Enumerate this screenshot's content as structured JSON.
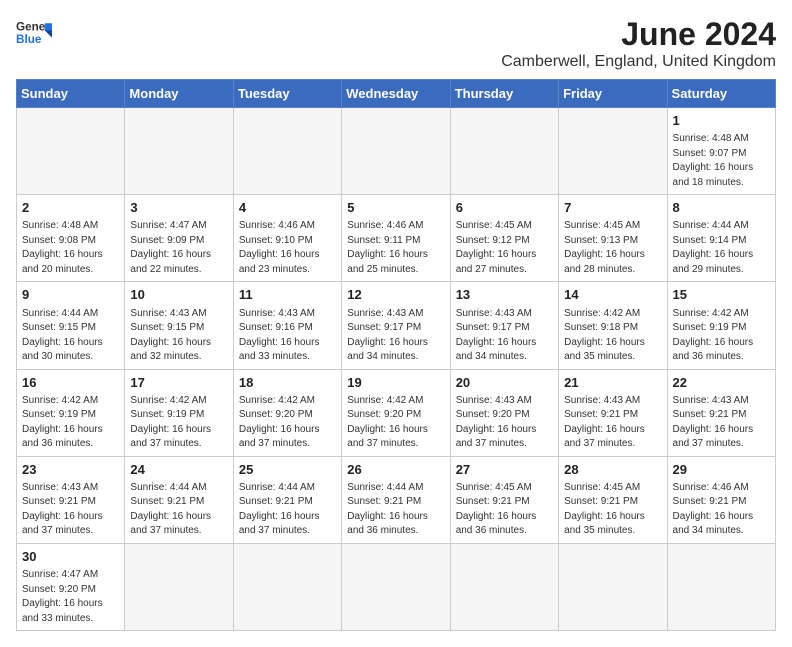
{
  "header": {
    "logo_text_general": "General",
    "logo_text_blue": "Blue",
    "month_title": "June 2024",
    "subtitle": "Camberwell, England, United Kingdom"
  },
  "weekdays": [
    "Sunday",
    "Monday",
    "Tuesday",
    "Wednesday",
    "Thursday",
    "Friday",
    "Saturday"
  ],
  "weeks": [
    [
      {
        "day": "",
        "info": ""
      },
      {
        "day": "",
        "info": ""
      },
      {
        "day": "",
        "info": ""
      },
      {
        "day": "",
        "info": ""
      },
      {
        "day": "",
        "info": ""
      },
      {
        "day": "",
        "info": ""
      },
      {
        "day": "1",
        "info": "Sunrise: 4:48 AM\nSunset: 9:07 PM\nDaylight: 16 hours\nand 18 minutes."
      }
    ],
    [
      {
        "day": "2",
        "info": "Sunrise: 4:48 AM\nSunset: 9:08 PM\nDaylight: 16 hours\nand 20 minutes."
      },
      {
        "day": "3",
        "info": "Sunrise: 4:47 AM\nSunset: 9:09 PM\nDaylight: 16 hours\nand 22 minutes."
      },
      {
        "day": "4",
        "info": "Sunrise: 4:46 AM\nSunset: 9:10 PM\nDaylight: 16 hours\nand 23 minutes."
      },
      {
        "day": "5",
        "info": "Sunrise: 4:46 AM\nSunset: 9:11 PM\nDaylight: 16 hours\nand 25 minutes."
      },
      {
        "day": "6",
        "info": "Sunrise: 4:45 AM\nSunset: 9:12 PM\nDaylight: 16 hours\nand 27 minutes."
      },
      {
        "day": "7",
        "info": "Sunrise: 4:45 AM\nSunset: 9:13 PM\nDaylight: 16 hours\nand 28 minutes."
      },
      {
        "day": "8",
        "info": "Sunrise: 4:44 AM\nSunset: 9:14 PM\nDaylight: 16 hours\nand 29 minutes."
      }
    ],
    [
      {
        "day": "9",
        "info": "Sunrise: 4:44 AM\nSunset: 9:15 PM\nDaylight: 16 hours\nand 30 minutes."
      },
      {
        "day": "10",
        "info": "Sunrise: 4:43 AM\nSunset: 9:15 PM\nDaylight: 16 hours\nand 32 minutes."
      },
      {
        "day": "11",
        "info": "Sunrise: 4:43 AM\nSunset: 9:16 PM\nDaylight: 16 hours\nand 33 minutes."
      },
      {
        "day": "12",
        "info": "Sunrise: 4:43 AM\nSunset: 9:17 PM\nDaylight: 16 hours\nand 34 minutes."
      },
      {
        "day": "13",
        "info": "Sunrise: 4:43 AM\nSunset: 9:17 PM\nDaylight: 16 hours\nand 34 minutes."
      },
      {
        "day": "14",
        "info": "Sunrise: 4:42 AM\nSunset: 9:18 PM\nDaylight: 16 hours\nand 35 minutes."
      },
      {
        "day": "15",
        "info": "Sunrise: 4:42 AM\nSunset: 9:19 PM\nDaylight: 16 hours\nand 36 minutes."
      }
    ],
    [
      {
        "day": "16",
        "info": "Sunrise: 4:42 AM\nSunset: 9:19 PM\nDaylight: 16 hours\nand 36 minutes."
      },
      {
        "day": "17",
        "info": "Sunrise: 4:42 AM\nSunset: 9:19 PM\nDaylight: 16 hours\nand 37 minutes."
      },
      {
        "day": "18",
        "info": "Sunrise: 4:42 AM\nSunset: 9:20 PM\nDaylight: 16 hours\nand 37 minutes."
      },
      {
        "day": "19",
        "info": "Sunrise: 4:42 AM\nSunset: 9:20 PM\nDaylight: 16 hours\nand 37 minutes."
      },
      {
        "day": "20",
        "info": "Sunrise: 4:43 AM\nSunset: 9:20 PM\nDaylight: 16 hours\nand 37 minutes."
      },
      {
        "day": "21",
        "info": "Sunrise: 4:43 AM\nSunset: 9:21 PM\nDaylight: 16 hours\nand 37 minutes."
      },
      {
        "day": "22",
        "info": "Sunrise: 4:43 AM\nSunset: 9:21 PM\nDaylight: 16 hours\nand 37 minutes."
      }
    ],
    [
      {
        "day": "23",
        "info": "Sunrise: 4:43 AM\nSunset: 9:21 PM\nDaylight: 16 hours\nand 37 minutes."
      },
      {
        "day": "24",
        "info": "Sunrise: 4:44 AM\nSunset: 9:21 PM\nDaylight: 16 hours\nand 37 minutes."
      },
      {
        "day": "25",
        "info": "Sunrise: 4:44 AM\nSunset: 9:21 PM\nDaylight: 16 hours\nand 37 minutes."
      },
      {
        "day": "26",
        "info": "Sunrise: 4:44 AM\nSunset: 9:21 PM\nDaylight: 16 hours\nand 36 minutes."
      },
      {
        "day": "27",
        "info": "Sunrise: 4:45 AM\nSunset: 9:21 PM\nDaylight: 16 hours\nand 36 minutes."
      },
      {
        "day": "28",
        "info": "Sunrise: 4:45 AM\nSunset: 9:21 PM\nDaylight: 16 hours\nand 35 minutes."
      },
      {
        "day": "29",
        "info": "Sunrise: 4:46 AM\nSunset: 9:21 PM\nDaylight: 16 hours\nand 34 minutes."
      }
    ],
    [
      {
        "day": "30",
        "info": "Sunrise: 4:47 AM\nSunset: 9:20 PM\nDaylight: 16 hours\nand 33 minutes."
      },
      {
        "day": "",
        "info": ""
      },
      {
        "day": "",
        "info": ""
      },
      {
        "day": "",
        "info": ""
      },
      {
        "day": "",
        "info": ""
      },
      {
        "day": "",
        "info": ""
      },
      {
        "day": "",
        "info": ""
      }
    ]
  ]
}
